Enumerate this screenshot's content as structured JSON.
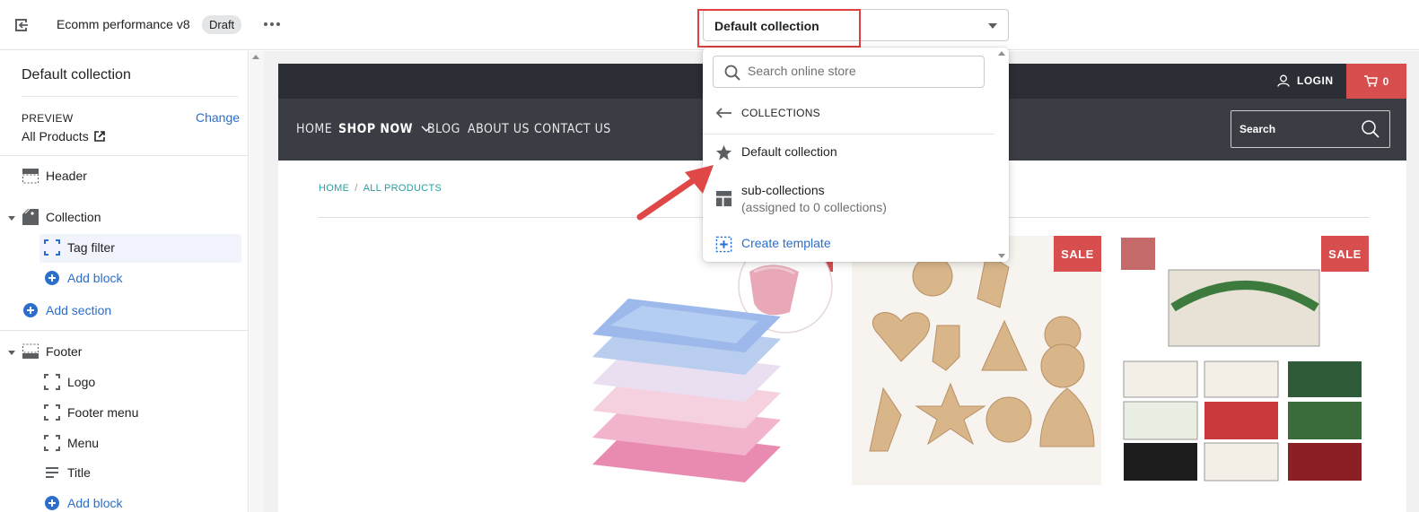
{
  "topbar": {
    "theme_name": "Ecomm performance v8",
    "status_badge": "Draft",
    "template_select_value": "Default collection"
  },
  "sidebar": {
    "title": "Default collection",
    "preview_label": "PREVIEW",
    "change_label": "Change",
    "preview_value": "All Products",
    "sections": {
      "header": "Header",
      "collection": "Collection",
      "tag_filter": "Tag filter",
      "add_block_1": "Add block",
      "add_section": "Add section",
      "footer": "Footer",
      "logo": "Logo",
      "footer_menu": "Footer menu",
      "menu": "Menu",
      "title_block": "Title",
      "add_block_2": "Add block"
    }
  },
  "dropdown": {
    "search_placeholder": "Search online store",
    "back_label": "COLLECTIONS",
    "items": {
      "default": "Default collection",
      "sub_title": "sub-collections",
      "sub_note": "(assigned to 0 collections)",
      "create": "Create template"
    }
  },
  "store": {
    "login": "LOGIN",
    "cart_count": "0",
    "nav": {
      "home": "HOME",
      "shop_now": "SHOP NOW",
      "blog": "BLOG",
      "about": "ABOUT US",
      "contact": "CONTACT US"
    },
    "search_placeholder": "Search",
    "breadcrumb": {
      "home": "HOME",
      "sep": "/",
      "current": "ALL PRODUCTS"
    },
    "sale_label": "SALE"
  },
  "colors": {
    "accent_link": "#2c6ecb",
    "highlight_red": "#e04040",
    "sale_red": "#d84e4e",
    "store_dark": "#2b2e34"
  }
}
